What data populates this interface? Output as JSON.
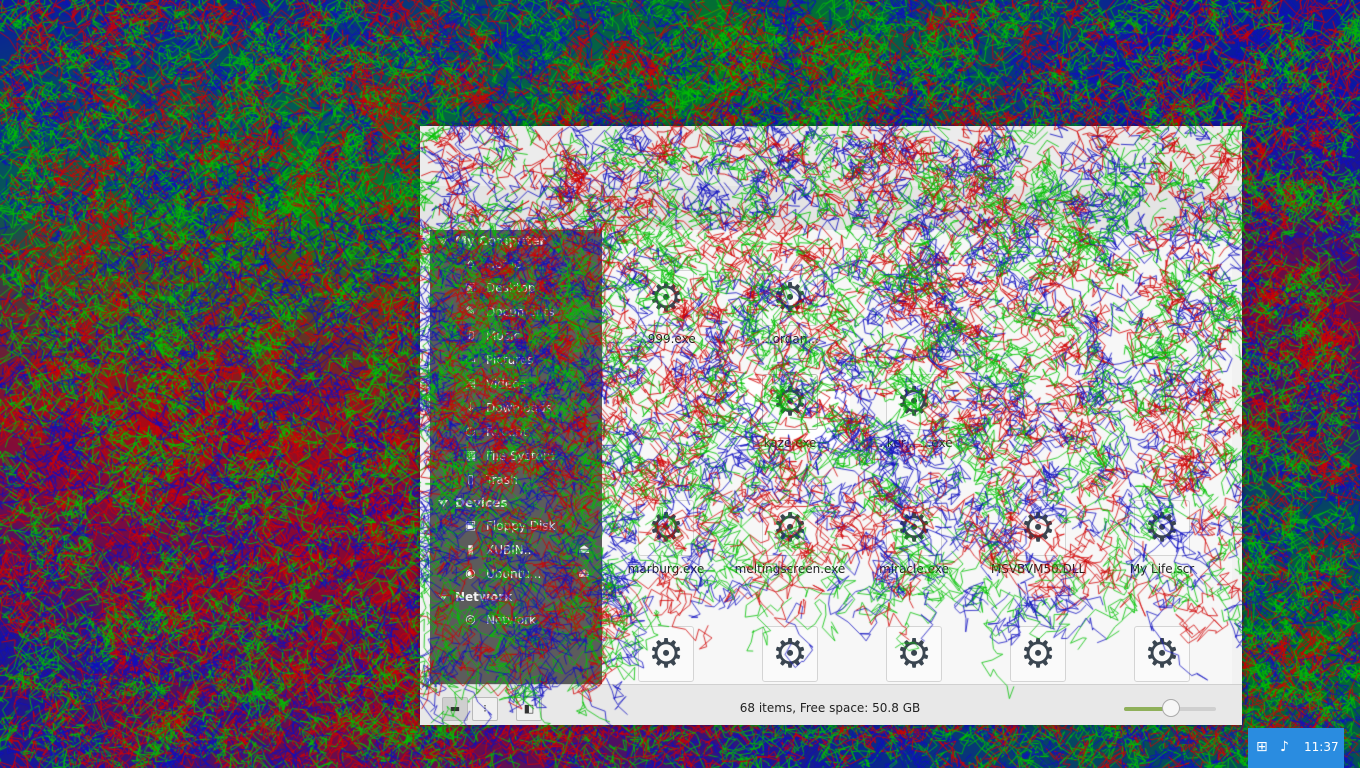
{
  "sidebar": {
    "sections": [
      {
        "label": "My Computer",
        "items": [
          {
            "label": "Home",
            "icon": "home-icon"
          },
          {
            "label": "Desktop",
            "icon": "desktop-icon"
          },
          {
            "label": "Documents",
            "icon": "documents-icon"
          },
          {
            "label": "Music",
            "icon": "music-icon"
          },
          {
            "label": "Pictures",
            "icon": "pictures-icon"
          },
          {
            "label": "Videos",
            "icon": "videos-icon"
          },
          {
            "label": "Downloads",
            "icon": "downloads-icon"
          },
          {
            "label": "Recent",
            "icon": "recent-icon"
          },
          {
            "label": "File System",
            "icon": "filesystem-icon"
          },
          {
            "label": "Trash",
            "icon": "trash-icon"
          }
        ]
      },
      {
        "label": "Devices",
        "items": [
          {
            "label": "Floppy Disk",
            "icon": "floppy-icon"
          },
          {
            "label": "XUBIN...",
            "icon": "usb-drive-icon",
            "eject": true
          },
          {
            "label": "Ubuntu...",
            "icon": "cdrom-icon",
            "eject": true
          }
        ]
      },
      {
        "label": "Network",
        "items": [
          {
            "label": "Network",
            "icon": "network-icon"
          }
        ]
      }
    ]
  },
  "files": {
    "row1": [
      {
        "name": "...999.exe"
      },
      {
        "name": "...organ..."
      }
    ],
    "row2": [
      {
        "name": "kaze.exe",
        "selected": true
      },
      {
        "name": "...ker...\n...exe"
      }
    ],
    "row3": [
      {
        "name": "marburg.exe"
      },
      {
        "name": "meltingscreen.exe"
      },
      {
        "name": "miracle.exe"
      },
      {
        "name": "MSVBVM50.DLL"
      },
      {
        "name": "My Life.scr"
      }
    ],
    "row4": [
      {
        "name": ""
      },
      {
        "name": ""
      },
      {
        "name": ""
      },
      {
        "name": ""
      },
      {
        "name": ""
      }
    ]
  },
  "statusbar": {
    "text": "68 items, Free space: 50.8 GB",
    "zoom_level": 0.5
  },
  "tray": {
    "time": "11:37"
  },
  "colors": {
    "sidebar_bg": "#5c5c5c",
    "tray_bg": "#2a8ce0",
    "zoom_fill": "#8fb05a"
  }
}
